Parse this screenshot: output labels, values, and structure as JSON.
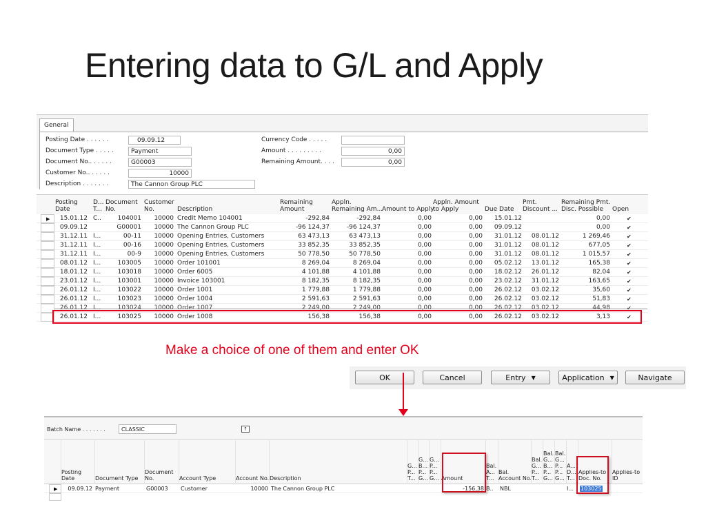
{
  "slide": {
    "title": "Entering data to G/L and Apply",
    "instruction": "Make a choice of one of them and enter OK"
  },
  "general": {
    "tab_label": "General",
    "fields": {
      "posting_date": {
        "label": "Posting Date . . . . . .",
        "value": "09.09.12"
      },
      "document_type": {
        "label": "Document Type . . . . .",
        "value": "Payment"
      },
      "document_no": {
        "label": "Document No.. . . . . .",
        "value": "G00003"
      },
      "customer_no": {
        "label": "Customer No.. . . . . .",
        "value": "10000"
      },
      "description": {
        "label": "Description . . . . . . .",
        "value": "The Cannon Group PLC"
      },
      "currency_code": {
        "label": "Currency Code . . . . .",
        "value": ""
      },
      "amount": {
        "label": "Amount . . . . . . . . .",
        "value": "0,00"
      },
      "remaining_amount": {
        "label": "Remaining Amount. . . .",
        "value": "0,00"
      }
    }
  },
  "entries_grid": {
    "columns": [
      {
        "key": "posting_date",
        "line1": "Posting",
        "line2": "Date"
      },
      {
        "key": "doc_type",
        "line1": "D...",
        "line2": "T..."
      },
      {
        "key": "doc_no",
        "line1": "Document",
        "line2": "No."
      },
      {
        "key": "customer_no",
        "line1": "Customer",
        "line2": "No."
      },
      {
        "key": "description",
        "line1": "",
        "line2": "Description"
      },
      {
        "key": "remaining_amount",
        "line1": "Remaining",
        "line2": "Amount"
      },
      {
        "key": "appln_remaining",
        "line1": "Appln.",
        "line2": "Remaining Am..."
      },
      {
        "key": "amount_to_apply",
        "line1": "",
        "line2": "Amount to Apply"
      },
      {
        "key": "appln_amount_to_apply",
        "line1": "Appln. Amount",
        "line2": "to Apply"
      },
      {
        "key": "due_date",
        "line1": "",
        "line2": "Due Date"
      },
      {
        "key": "pmt_discount",
        "line1": "Pmt.",
        "line2": "Discount ..."
      },
      {
        "key": "remaining_pmt_disc",
        "line1": "Remaining Pmt.",
        "line2": "Disc. Possible"
      },
      {
        "key": "open",
        "line1": "",
        "line2": "Open"
      }
    ],
    "rows": [
      {
        "current": true,
        "posting_date": "15.01.12",
        "doc_type": "C..",
        "doc_no": "104001",
        "customer_no": "10000",
        "description": "Credit Memo 104001",
        "remaining_amount": "-292,84",
        "appln_remaining": "-292,84",
        "amount_to_apply": "0,00",
        "appln_amount_to_apply": "0,00",
        "due_date": "15.01.12",
        "pmt_discount": "",
        "remaining_pmt_disc": "0,00",
        "open": "✔"
      },
      {
        "posting_date": "09.09.12",
        "doc_type": "",
        "doc_no": "G00001",
        "customer_no": "10000",
        "description": "The Cannon Group PLC",
        "remaining_amount": "-96 124,37",
        "appln_remaining": "-96 124,37",
        "amount_to_apply": "0,00",
        "appln_amount_to_apply": "0,00",
        "due_date": "09.09.12",
        "pmt_discount": "",
        "remaining_pmt_disc": "0,00",
        "open": "✔"
      },
      {
        "posting_date": "31.12.11",
        "doc_type": "I...",
        "doc_no": "00-11",
        "customer_no": "10000",
        "description": "Opening Entries, Customers",
        "remaining_amount": "63 473,13",
        "appln_remaining": "63 473,13",
        "amount_to_apply": "0,00",
        "appln_amount_to_apply": "0,00",
        "due_date": "31.01.12",
        "pmt_discount": "08.01.12",
        "remaining_pmt_disc": "1 269,46",
        "open": "✔"
      },
      {
        "posting_date": "31.12.11",
        "doc_type": "I...",
        "doc_no": "00-16",
        "customer_no": "10000",
        "description": "Opening Entries, Customers",
        "remaining_amount": "33 852,35",
        "appln_remaining": "33 852,35",
        "amount_to_apply": "0,00",
        "appln_amount_to_apply": "0,00",
        "due_date": "31.01.12",
        "pmt_discount": "08.01.12",
        "remaining_pmt_disc": "677,05",
        "open": "✔"
      },
      {
        "posting_date": "31.12.11",
        "doc_type": "I...",
        "doc_no": "00-9",
        "customer_no": "10000",
        "description": "Opening Entries, Customers",
        "remaining_amount": "50 778,50",
        "appln_remaining": "50 778,50",
        "amount_to_apply": "0,00",
        "appln_amount_to_apply": "0,00",
        "due_date": "31.01.12",
        "pmt_discount": "08.01.12",
        "remaining_pmt_disc": "1 015,57",
        "open": "✔"
      },
      {
        "posting_date": "08.01.12",
        "doc_type": "I...",
        "doc_no": "103005",
        "customer_no": "10000",
        "description": "Order 101001",
        "remaining_amount": "8 269,04",
        "appln_remaining": "8 269,04",
        "amount_to_apply": "0,00",
        "appln_amount_to_apply": "0,00",
        "due_date": "05.02.12",
        "pmt_discount": "13.01.12",
        "remaining_pmt_disc": "165,38",
        "open": "✔"
      },
      {
        "posting_date": "18.01.12",
        "doc_type": "I...",
        "doc_no": "103018",
        "customer_no": "10000",
        "description": "Order 6005",
        "remaining_amount": "4 101,88",
        "appln_remaining": "4 101,88",
        "amount_to_apply": "0,00",
        "appln_amount_to_apply": "0,00",
        "due_date": "18.02.12",
        "pmt_discount": "26.01.12",
        "remaining_pmt_disc": "82,04",
        "open": "✔"
      },
      {
        "posting_date": "23.01.12",
        "doc_type": "I...",
        "doc_no": "103001",
        "customer_no": "10000",
        "description": "Invoice 103001",
        "remaining_amount": "8 182,35",
        "appln_remaining": "8 182,35",
        "amount_to_apply": "0,00",
        "appln_amount_to_apply": "0,00",
        "due_date": "23.02.12",
        "pmt_discount": "31.01.12",
        "remaining_pmt_disc": "163,65",
        "open": "✔"
      },
      {
        "posting_date": "26.01.12",
        "doc_type": "I...",
        "doc_no": "103022",
        "customer_no": "10000",
        "description": "Order 1001",
        "remaining_amount": "1 779,88",
        "appln_remaining": "1 779,88",
        "amount_to_apply": "0,00",
        "appln_amount_to_apply": "0,00",
        "due_date": "26.02.12",
        "pmt_discount": "03.02.12",
        "remaining_pmt_disc": "35,60",
        "open": "✔"
      },
      {
        "posting_date": "26.01.12",
        "doc_type": "I...",
        "doc_no": "103023",
        "customer_no": "10000",
        "description": "Order 1004",
        "remaining_amount": "2 591,63",
        "appln_remaining": "2 591,63",
        "amount_to_apply": "0,00",
        "appln_amount_to_apply": "0,00",
        "due_date": "26.02.12",
        "pmt_discount": "03.02.12",
        "remaining_pmt_disc": "51,83",
        "open": "✔"
      },
      {
        "struck": true,
        "posting_date": "26.01.12",
        "doc_type": "I...",
        "doc_no": "103024",
        "customer_no": "10000",
        "description": "Order 1007",
        "remaining_amount": "2 249,00",
        "appln_remaining": "2 249,00",
        "amount_to_apply": "0,00",
        "appln_amount_to_apply": "0,00",
        "due_date": "26.02.12",
        "pmt_discount": "03.02.12",
        "remaining_pmt_disc": "44,98",
        "open": "✔"
      },
      {
        "highlighted": true,
        "posting_date": "26.01.12",
        "doc_type": "I...",
        "doc_no": "103025",
        "customer_no": "10000",
        "description": "Order 1008",
        "remaining_amount": "156,38",
        "appln_remaining": "156,38",
        "amount_to_apply": "0,00",
        "appln_amount_to_apply": "0,00",
        "due_date": "26.02.12",
        "pmt_discount": "03.02.12",
        "remaining_pmt_disc": "3,13",
        "open": "✔"
      }
    ]
  },
  "buttons": {
    "ok": "OK",
    "cancel": "Cancel",
    "entry": "Entry",
    "application": "Application",
    "navigate": "Navigate",
    "caret": "▼"
  },
  "journal": {
    "batch_label": "Batch Name . . . . . . .",
    "batch_value": "CLASSIC",
    "batch_lookup_icon": "↑",
    "headers": [
      {
        "key": "posting_date",
        "text": "Posting\nDate"
      },
      {
        "key": "document_type",
        "text": "Document Type"
      },
      {
        "key": "document_no",
        "text": "Document\nNo."
      },
      {
        "key": "account_type",
        "text": "Account Type"
      },
      {
        "key": "account_no",
        "text": "Account No."
      },
      {
        "key": "description",
        "text": "Description"
      },
      {
        "key": "gp_t",
        "text": "G...\nP...\nT..."
      },
      {
        "key": "gb_g",
        "text": "G...\nB...\nP...\nG..."
      },
      {
        "key": "gp_g",
        "text": "G...\nP...\nP...\nG..."
      },
      {
        "key": "amount",
        "text": "Amount"
      },
      {
        "key": "bal_acc_type",
        "text": "Bal.\nA...\nT..."
      },
      {
        "key": "bal_account_no",
        "text": "Bal.\nAccount No."
      },
      {
        "key": "bal_gp_t",
        "text": "Bal.\nG...\nP...\nT..."
      },
      {
        "key": "bal_gb_g",
        "text": "Bal.\nG...\nB...\nP...\nG..."
      },
      {
        "key": "bal_gp_g",
        "text": "Bal.\nG...\nP...\nP...\nG..."
      },
      {
        "key": "ad_t",
        "text": "A...\nD...\nT..."
      },
      {
        "key": "applies_to_doc_no",
        "text": "Applies-to\nDoc. No."
      },
      {
        "key": "applies_to_id",
        "text": "Applies-to\nID"
      }
    ],
    "row": {
      "posting_date": "09.09.12",
      "document_type": "Payment",
      "document_no": "G00003",
      "account_type": "Customer",
      "account_no": "10000",
      "description": "The Cannon Group PLC",
      "amount": "-156,38",
      "bal_acc_type": "B..",
      "bal_account_no": "NBL",
      "ad_t": "I...",
      "applies_to_doc_no": "103025",
      "applies_to_id": ""
    }
  },
  "colors": {
    "annotation_red": "#e3001b",
    "selection_blue": "#3b78d8"
  }
}
